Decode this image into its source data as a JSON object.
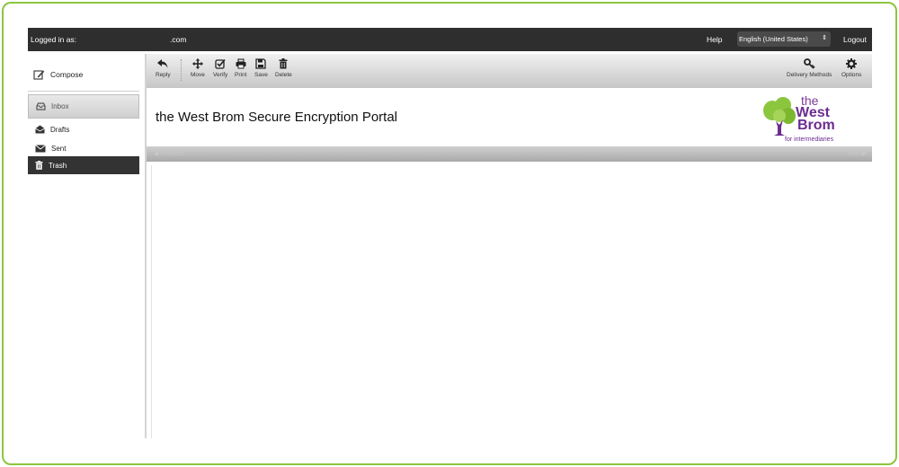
{
  "topbar": {
    "logged_in_label": "Logged in as:",
    "email_suffix": ".com",
    "help": "Help",
    "language": "English (United States)",
    "logout": "Logout"
  },
  "sidebar": {
    "compose": "Compose",
    "items": [
      {
        "label": "Inbox",
        "icon": "inbox-icon"
      },
      {
        "label": "Drafts",
        "icon": "drafts-icon"
      },
      {
        "label": "Sent",
        "icon": "sent-icon"
      },
      {
        "label": "Trash",
        "icon": "trash-icon"
      }
    ]
  },
  "toolbar": {
    "reply": "Reply",
    "move": "Move",
    "verify": "Verify",
    "print": "Print",
    "save": "Save",
    "delete": "Delete",
    "delivery_methods": "Delivery Methods",
    "options": "Options"
  },
  "header": {
    "title": "the West Brom Secure Encryption Portal",
    "logo": {
      "the": "the",
      "west": "West",
      "brom": "Brom",
      "sub": "for intermediaries",
      "green": "#8cc63f",
      "purple": "#6b2c8f"
    }
  },
  "pager": {
    "previous": "Previous",
    "next": "Next"
  },
  "colors": {
    "frame_border": "#8cc63f",
    "topbar_bg": "#2e2e2e",
    "selected_nav_bg": "#333333"
  }
}
